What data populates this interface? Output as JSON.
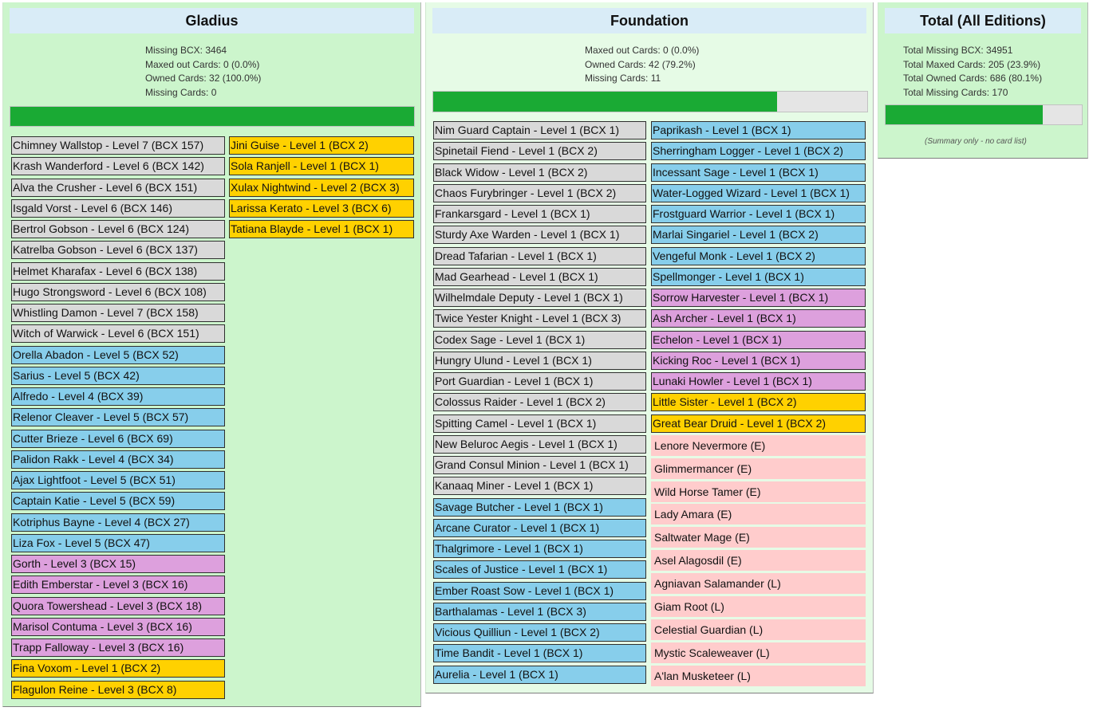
{
  "panels": {
    "gladius": {
      "title": "Gladius",
      "stats": [
        "Missing BCX: 3464",
        "Maxed out Cards: 0 (0.0%)",
        "Owned Cards: 32 (100.0%)",
        "Missing Cards: 0"
      ],
      "progress": 1.0,
      "columns": [
        [
          {
            "label": "Chimney Wallstop - Level 7 (BCX 157)",
            "rarity": "owned"
          },
          {
            "label": "Krash Wanderford - Level 6 (BCX 142)",
            "rarity": "owned"
          },
          {
            "label": "Alva the Crusher - Level 6 (BCX 151)",
            "rarity": "owned"
          },
          {
            "label": "Isgald Vorst - Level 6 (BCX 146)",
            "rarity": "owned"
          },
          {
            "label": "Bertrol Gobson - Level 6 (BCX 124)",
            "rarity": "owned"
          },
          {
            "label": "Katrelba Gobson - Level 6 (BCX 137)",
            "rarity": "owned"
          },
          {
            "label": "Helmet Kharafax - Level 6 (BCX 138)",
            "rarity": "owned"
          },
          {
            "label": "Hugo Strongsword - Level 6 (BCX 108)",
            "rarity": "owned"
          },
          {
            "label": "Whistling Damon - Level 7 (BCX 158)",
            "rarity": "owned"
          },
          {
            "label": "Witch of Warwick - Level 6 (BCX 151)",
            "rarity": "owned"
          },
          {
            "label": "Orella Abadon - Level 5 (BCX 52)",
            "rarity": "rare"
          },
          {
            "label": "Sarius - Level 5 (BCX 42)",
            "rarity": "rare"
          },
          {
            "label": "Alfredo - Level 4 (BCX 39)",
            "rarity": "rare"
          },
          {
            "label": "Relenor Cleaver - Level 5 (BCX 57)",
            "rarity": "rare"
          },
          {
            "label": "Cutter Brieze - Level 6 (BCX 69)",
            "rarity": "rare"
          },
          {
            "label": "Palidon Rakk - Level 4 (BCX 34)",
            "rarity": "rare"
          },
          {
            "label": "Ajax Lightfoot - Level 5 (BCX 51)",
            "rarity": "rare"
          },
          {
            "label": "Captain Katie - Level 5 (BCX 59)",
            "rarity": "rare"
          },
          {
            "label": "Kotriphus Bayne - Level 4 (BCX 27)",
            "rarity": "rare"
          },
          {
            "label": "Liza Fox - Level 5 (BCX 47)",
            "rarity": "rare"
          },
          {
            "label": "Gorth - Level 3 (BCX 15)",
            "rarity": "epic"
          },
          {
            "label": "Edith Emberstar - Level 3 (BCX 16)",
            "rarity": "epic"
          },
          {
            "label": "Quora Towershead - Level 3 (BCX 18)",
            "rarity": "epic"
          },
          {
            "label": "Marisol Contuma - Level 3 (BCX 16)",
            "rarity": "epic"
          },
          {
            "label": "Trapp Falloway - Level 3 (BCX 16)",
            "rarity": "epic"
          },
          {
            "label": "Fina Voxom - Level 1 (BCX 2)",
            "rarity": "legendary"
          },
          {
            "label": "Flagulon Reine - Level 3 (BCX 8)",
            "rarity": "legendary"
          }
        ],
        [
          {
            "label": "Jini Guise - Level 1 (BCX 2)",
            "rarity": "legendary"
          },
          {
            "label": "Sola Ranjell - Level 1 (BCX 1)",
            "rarity": "legendary"
          },
          {
            "label": "Xulax Nightwind - Level 2 (BCX 3)",
            "rarity": "legendary"
          },
          {
            "label": "Larissa Kerato - Level 3 (BCX 6)",
            "rarity": "legendary"
          },
          {
            "label": "Tatiana Blayde - Level 1 (BCX 1)",
            "rarity": "legendary"
          }
        ]
      ]
    },
    "foundation": {
      "title": "Foundation",
      "stats": [
        "Maxed out Cards: 0 (0.0%)",
        "Owned Cards: 42 (79.2%)",
        "Missing Cards: 11"
      ],
      "progress": 0.792,
      "columns": [
        [
          {
            "label": "Nim Guard Captain - Level 1 (BCX 1)",
            "rarity": "owned"
          },
          {
            "label": "Spinetail Fiend - Level 1 (BCX 2)",
            "rarity": "owned"
          },
          {
            "label": "Black Widow - Level 1 (BCX 2)",
            "rarity": "owned"
          },
          {
            "label": "Chaos Furybringer - Level 1 (BCX 2)",
            "rarity": "owned"
          },
          {
            "label": "Frankarsgard - Level 1 (BCX 1)",
            "rarity": "owned"
          },
          {
            "label": "Sturdy Axe Warden - Level 1 (BCX 1)",
            "rarity": "owned"
          },
          {
            "label": "Dread Tafarian - Level 1 (BCX 1)",
            "rarity": "owned"
          },
          {
            "label": "Mad Gearhead - Level 1 (BCX 1)",
            "rarity": "owned"
          },
          {
            "label": "Wilhelmdale Deputy - Level 1 (BCX 1)",
            "rarity": "owned"
          },
          {
            "label": "Twice Yester Knight - Level 1 (BCX 3)",
            "rarity": "owned"
          },
          {
            "label": "Codex Sage - Level 1 (BCX 1)",
            "rarity": "owned"
          },
          {
            "label": "Hungry Ulund - Level 1 (BCX 1)",
            "rarity": "owned"
          },
          {
            "label": "Port Guardian - Level 1 (BCX 1)",
            "rarity": "owned"
          },
          {
            "label": "Colossus Raider - Level 1 (BCX 2)",
            "rarity": "owned"
          },
          {
            "label": "Spitting Camel - Level 1 (BCX 1)",
            "rarity": "owned"
          },
          {
            "label": "New Beluroc Aegis - Level 1 (BCX 1)",
            "rarity": "owned"
          },
          {
            "label": "Grand Consul Minion - Level 1 (BCX 1)",
            "rarity": "owned"
          },
          {
            "label": "Kanaaq Miner - Level 1 (BCX 1)",
            "rarity": "owned"
          },
          {
            "label": "Savage Butcher - Level 1 (BCX 1)",
            "rarity": "rare"
          },
          {
            "label": "Arcane Curator - Level 1 (BCX 1)",
            "rarity": "rare"
          },
          {
            "label": "Thalgrimore - Level 1 (BCX 1)",
            "rarity": "rare"
          },
          {
            "label": "Scales of Justice - Level 1 (BCX 1)",
            "rarity": "rare"
          },
          {
            "label": "Ember Roast Sow - Level 1 (BCX 1)",
            "rarity": "rare"
          },
          {
            "label": "Barthalamas - Level 1 (BCX 3)",
            "rarity": "rare"
          },
          {
            "label": "Vicious Quilliun - Level 1 (BCX 2)",
            "rarity": "rare"
          },
          {
            "label": "Time Bandit - Level 1 (BCX 1)",
            "rarity": "rare"
          },
          {
            "label": "Aurelia - Level 1 (BCX 1)",
            "rarity": "rare"
          }
        ],
        [
          {
            "label": "Paprikash - Level 1 (BCX 1)",
            "rarity": "rare"
          },
          {
            "label": "Sherringham Logger - Level 1 (BCX 2)",
            "rarity": "rare"
          },
          {
            "label": "Incessant Sage - Level 1 (BCX 1)",
            "rarity": "rare"
          },
          {
            "label": "Water-Logged Wizard - Level 1 (BCX 1)",
            "rarity": "rare"
          },
          {
            "label": "Frostguard Warrior - Level 1 (BCX 1)",
            "rarity": "rare"
          },
          {
            "label": "Marlai Singariel - Level 1 (BCX 2)",
            "rarity": "rare"
          },
          {
            "label": "Vengeful Monk - Level 1 (BCX 2)",
            "rarity": "rare"
          },
          {
            "label": "Spellmonger - Level 1 (BCX 1)",
            "rarity": "rare"
          },
          {
            "label": "Sorrow Harvester - Level 1 (BCX 1)",
            "rarity": "epic"
          },
          {
            "label": "Ash Archer - Level 1 (BCX 1)",
            "rarity": "epic"
          },
          {
            "label": "Echelon - Level 1 (BCX 1)",
            "rarity": "epic"
          },
          {
            "label": "Kicking Roc - Level 1 (BCX 1)",
            "rarity": "epic"
          },
          {
            "label": "Lunaki Howler - Level 1 (BCX 1)",
            "rarity": "epic"
          },
          {
            "label": "Little Sister - Level 1 (BCX 2)",
            "rarity": "legendary"
          },
          {
            "label": "Great Bear Druid - Level 1 (BCX 2)",
            "rarity": "legendary"
          },
          {
            "label": "Lenore Nevermore (E)",
            "rarity": "missing"
          },
          {
            "label": "Glimmermancer (E)",
            "rarity": "missing"
          },
          {
            "label": "Wild Horse Tamer (E)",
            "rarity": "missing"
          },
          {
            "label": "Lady Amara (E)",
            "rarity": "missing"
          },
          {
            "label": "Saltwater Mage (E)",
            "rarity": "missing"
          },
          {
            "label": "Asel Alagosdil (E)",
            "rarity": "missing"
          },
          {
            "label": "Agniavan Salamander (L)",
            "rarity": "missing"
          },
          {
            "label": "Giam Root (L)",
            "rarity": "missing"
          },
          {
            "label": "Celestial Guardian (L)",
            "rarity": "missing"
          },
          {
            "label": "Mystic Scaleweaver (L)",
            "rarity": "missing"
          },
          {
            "label": "A'lan Musketeer (L)",
            "rarity": "missing"
          }
        ]
      ]
    },
    "total": {
      "title": "Total (All Editions)",
      "stats": [
        "Total Missing BCX: 34951",
        "Total Maxed Cards: 205 (23.9%)",
        "Total Owned Cards: 686 (80.1%)",
        "Total Missing Cards: 170"
      ],
      "progress": 0.801,
      "note": "(Summary only - no card list)"
    }
  },
  "colors": {
    "panel_background": "#ccf5cc",
    "panel_background_light": "#e6fbe6",
    "title_background": "#d9ecf7",
    "progress_fill": "#1aaa34",
    "progress_track": "#e5e5e5",
    "owned": "#d9d9d9",
    "rare": "#87ceeb",
    "epic": "#dda0dd",
    "legendary": "#ffd100",
    "missing": "#ffcccc"
  }
}
